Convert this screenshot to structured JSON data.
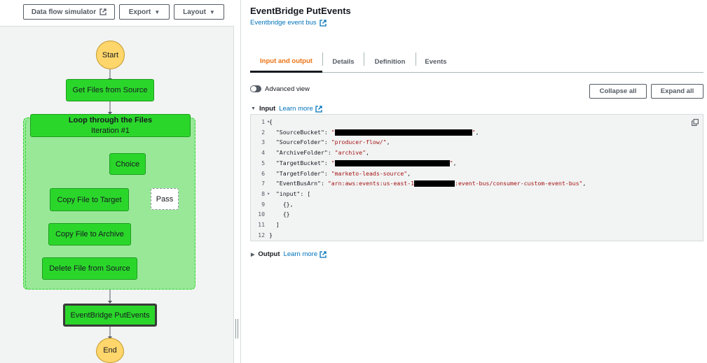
{
  "toolbar": {
    "data_flow_label": "Data flow simulator",
    "export_label": "Export",
    "layout_label": "Layout"
  },
  "graph": {
    "start": "Start",
    "get_files": "Get Files from Source",
    "loop_title": "Loop through the Files",
    "loop_iteration": "Iteration #1",
    "choice": "Choice",
    "copy_target": "Copy File to Target",
    "pass": "Pass",
    "copy_archive": "Copy File to Archive",
    "delete_file": "Delete File from Source",
    "eventbridge": "EventBridge PutEvents",
    "end": "End"
  },
  "details": {
    "title": "EventBridge PutEvents",
    "link": "Eventbridge event bus",
    "tabs": [
      "Input and output",
      "Details",
      "Definition",
      "Events"
    ],
    "advanced_view": "Advanced view",
    "collapse_all": "Collapse all",
    "expand_all": "Expand all",
    "input_label": "Input",
    "output_label": "Output",
    "learn_more": "Learn more"
  },
  "code": {
    "line_numbers": [
      "1",
      "2",
      "3",
      "4",
      "5",
      "6",
      "7",
      "8",
      "9",
      "10",
      "11",
      "12"
    ],
    "source_bucket_key": "\"SourceBucket\"",
    "source_folder_key": "\"SourceFolder\"",
    "source_folder_val": "\"producer-flow/\"",
    "archive_folder_key": "\"ArchiveFolder\"",
    "archive_folder_val": "\"archive\"",
    "target_bucket_key": "\"TargetBucket\"",
    "target_folder_key": "\"TargetFolder\"",
    "target_folder_val": "\"marketo-leads-source\"",
    "event_bus_key": "\"EventBusArn\"",
    "event_bus_val_start": "\"arn:aws:events:us-east-1",
    "event_bus_val_end": ":event-bus/consumer-custom-event-bus\"",
    "input_key": "\"input\""
  },
  "colors": {
    "task_green": "#2bd62b",
    "loop_green": "#98e898",
    "start_end_yellow": "#ffd66b",
    "link_blue": "#0073bb",
    "active_tab_orange": "#ec7211"
  }
}
